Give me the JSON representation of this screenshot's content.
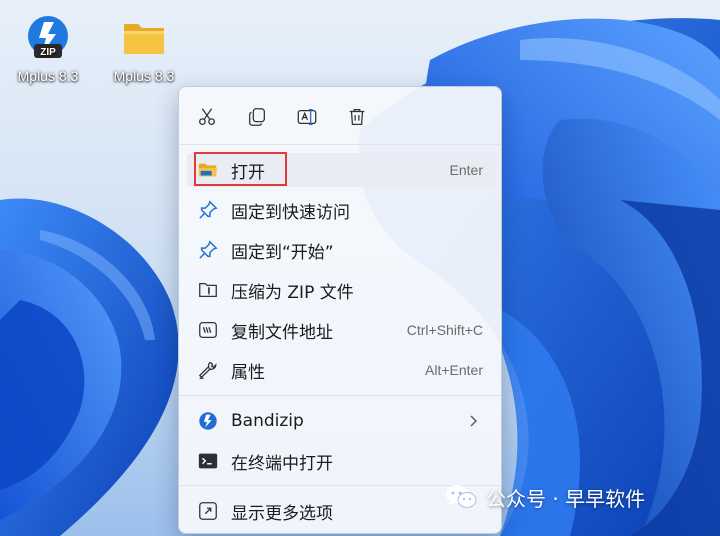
{
  "desktop": {
    "icons": [
      {
        "label": "Mplus 8.3",
        "icon": "bandizip-zip-icon"
      },
      {
        "label": "Mplus 8.3",
        "icon": "folder-icon"
      }
    ]
  },
  "context_menu": {
    "toolbar": [
      {
        "name": "cut",
        "icon": "scissors-icon"
      },
      {
        "name": "copy",
        "icon": "copy-icon"
      },
      {
        "name": "rename",
        "icon": "rename-icon"
      },
      {
        "name": "delete",
        "icon": "trash-icon"
      }
    ],
    "items": [
      {
        "label": "打开",
        "shortcut": "Enter",
        "icon": "folder-open-icon"
      },
      {
        "label": "固定到快速访问",
        "shortcut": "",
        "icon": "pin-icon"
      },
      {
        "label": "固定到“开始”",
        "shortcut": "",
        "icon": "pin-icon"
      },
      {
        "label": "压缩为 ZIP 文件",
        "shortcut": "",
        "icon": "zip-folder-icon"
      },
      {
        "label": "复制文件地址",
        "shortcut": "Ctrl+Shift+C",
        "icon": "copy-path-icon"
      },
      {
        "label": "属性",
        "shortcut": "Alt+Enter",
        "icon": "wrench-icon"
      },
      {
        "label": "Bandizip",
        "shortcut": "",
        "icon": "bandizip-icon",
        "submenu": true
      },
      {
        "label": "在终端中打开",
        "shortcut": "",
        "icon": "terminal-icon"
      },
      {
        "label": "显示更多选项",
        "shortcut": "",
        "icon": "more-options-icon"
      }
    ]
  },
  "watermark": {
    "text": "公众号 · 早早软件"
  },
  "colors": {
    "accent_blue": "#1f6fd1",
    "highlight_red": "#e3393b",
    "folder_yellow": "#f6c343"
  }
}
